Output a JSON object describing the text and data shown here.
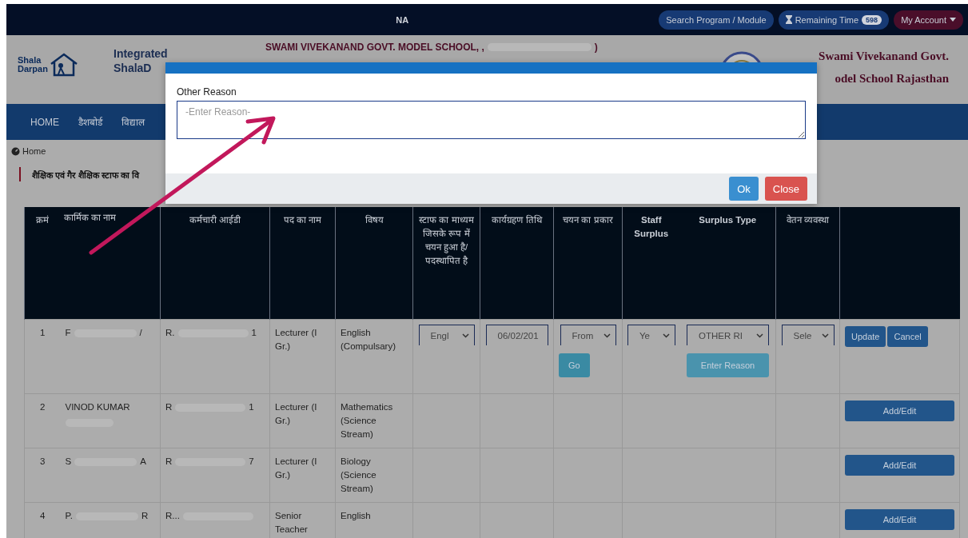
{
  "top_bar": {
    "center_text": "NA",
    "search_button": "Search Program / Module",
    "remaining_time": {
      "label": "Remaining Time",
      "count": "598"
    },
    "account_menu": "My Account"
  },
  "header": {
    "logo_text": [
      "Shala",
      "Darpan"
    ],
    "portal_title": [
      "Integrated",
      "ShalaD"
    ],
    "school_name": {
      "start": "SWAMI VIVEKANAND GOVT. MODEL SCHOOL, ,",
      "end": ")"
    },
    "brand_text": [
      "Swami Vivekanand Govt.",
      "odel School Rajasthan"
    ]
  },
  "nav": [
    "HOME",
    "डैशबोर्ड",
    "विद्याल"
  ],
  "breadcrumb": "Home",
  "page_title": "शैक्षिक एवं गैर शैक्षिक स्टाफ का वि",
  "modal": {
    "label": "Other Reason",
    "placeholder": "-Enter Reason-",
    "buttons": [
      {
        "label": "Ok",
        "kind": "primary"
      },
      {
        "label": "Close",
        "kind": "danger"
      }
    ]
  },
  "table": {
    "columns": [
      "क्रमं",
      "कार्मिक का नाम",
      "कर्मचारी आईडी",
      "पद का नाम",
      "विषय",
      "स्टाफ का माध्यम जिसके रूप में चयन हुआ है/ पदस्थापित है",
      "कार्यग्रहण तिथि",
      "चयन का प्रकार",
      "Staff Surplus",
      "Surplus Type",
      "वेतन व्यवस्था"
    ],
    "rows": [
      {
        "no": "1",
        "name_start": "F",
        "name_end": "/",
        "id_start": "R.",
        "id_end": "1",
        "post": "Lecturer (I Gr.)",
        "subject": "English (Compulsary)",
        "editing": true,
        "medium": "Engl",
        "join_date": "06/02/201",
        "selection": "From",
        "go": "Go",
        "surplus": "Ye",
        "surplus_type": "OTHER RI",
        "reason_button": "Enter Reason",
        "salary": "Sele",
        "actions": [
          "Update",
          "Cancel"
        ]
      },
      {
        "no": "2",
        "name_start": "VINOD KUMAR",
        "name_end": "",
        "id_start": "R",
        "id_end": "1",
        "post": "Lecturer (I Gr.)",
        "subject": "Mathematics (Science Stream)",
        "editing": false,
        "actions": [
          "Add/Edit"
        ]
      },
      {
        "no": "3",
        "name_start": "S",
        "name_end": "A",
        "id_start": "R",
        "id_end": "7",
        "post": "Lecturer (I Gr.)",
        "subject": "Biology (Science Stream)",
        "editing": false,
        "actions": [
          "Add/Edit"
        ]
      },
      {
        "no": "4",
        "name_start": "P.",
        "name_end": "R",
        "id_start": "R...",
        "id_end": "",
        "post": "Senior Teacher",
        "subject": "English",
        "editing": false,
        "actions": [
          "Add/Edit"
        ]
      }
    ]
  }
}
